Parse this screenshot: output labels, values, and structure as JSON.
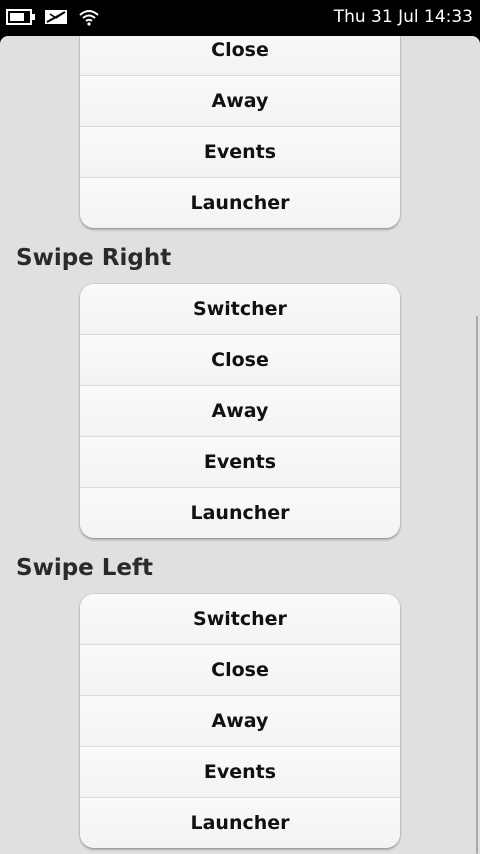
{
  "status": {
    "clock": "Thu 31 Jul 14:33",
    "icons": [
      "battery-icon",
      "mail-sync-icon",
      "wifi-icon"
    ]
  },
  "groups": [
    {
      "title": "",
      "items": [
        "Close",
        "Away",
        "Events",
        "Launcher"
      ]
    },
    {
      "title": "Swipe Right",
      "items": [
        "Switcher",
        "Close",
        "Away",
        "Events",
        "Launcher"
      ]
    },
    {
      "title": "Swipe Left",
      "items": [
        "Switcher",
        "Close",
        "Away",
        "Events",
        "Launcher"
      ]
    }
  ]
}
